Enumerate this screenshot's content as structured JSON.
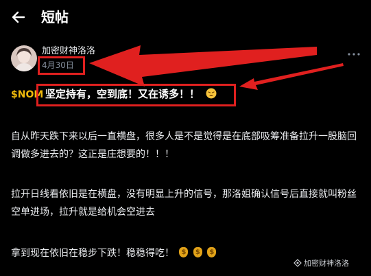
{
  "header": {
    "title": "短帖"
  },
  "post": {
    "author": "加密财神洛洛",
    "date": "4月30日",
    "ticker": "$NOM",
    "headline": "坚定持有，空到底！又在诱多！！",
    "paragraphs": [
      "自从昨天跌下来以后一直横盘，很多人是不是觉得是在底部吸筹准备拉升一股脑回调做多进去的？这正是庄想要的！！！",
      "拉开日线看依旧是在横盘，没有明显上升的信号，那洛姐确认信号后直接就叫粉丝空单进场，拉升就是给机会空进去",
      "拿到现在依旧在稳步下跌！稳稳得吃！"
    ]
  },
  "watermark": "加密财神洛洛",
  "colors": {
    "background": "#000000",
    "ticker": "#f0b90b",
    "annotation": "#e0201f",
    "muted": "#848e9c"
  },
  "icons": [
    "back-arrow-icon",
    "more-icon",
    "tired-face-emoji",
    "money-bag-emoji",
    "watermark-logo-icon"
  ]
}
